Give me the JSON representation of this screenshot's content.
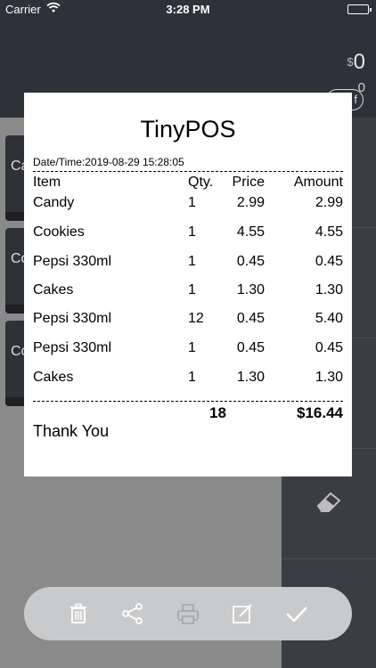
{
  "status": {
    "carrier": "Carrier",
    "time": "3:28 PM"
  },
  "header": {
    "currency": "$",
    "total": "0",
    "count": "0"
  },
  "left_cards": [
    "Ca",
    "Co",
    "Co"
  ],
  "receipt": {
    "title": "TinyPOS",
    "datetime": "Date/Time:2019-08-29 15:28:05",
    "columns": {
      "item": "Item",
      "qty": "Qty.",
      "price": "Price",
      "amount": "Amount"
    },
    "rows": [
      {
        "item": "Candy",
        "qty": "1",
        "price": "2.99",
        "amount": "2.99"
      },
      {
        "item": "Cookies",
        "qty": "1",
        "price": "4.55",
        "amount": "4.55"
      },
      {
        "item": "Pepsi 330ml",
        "qty": "1",
        "price": "0.45",
        "amount": "0.45"
      },
      {
        "item": "Cakes",
        "qty": "1",
        "price": "1.30",
        "amount": "1.30"
      },
      {
        "item": "Pepsi 330ml",
        "qty": "12",
        "price": "0.45",
        "amount": "5.40"
      },
      {
        "item": "Pepsi 330ml",
        "qty": "1",
        "price": "0.45",
        "amount": "0.45"
      },
      {
        "item": "Cakes",
        "qty": "1",
        "price": "1.30",
        "amount": "1.30"
      }
    ],
    "total_qty": "18",
    "total_amount": "$16.44",
    "footer": "Thank You"
  },
  "toolbar": {
    "icons": [
      "trash-icon",
      "share-icon",
      "print-icon",
      "edit-icon",
      "checkmark-icon"
    ]
  },
  "colors": {
    "header_bg": "#2d323a",
    "toolbar_bg": "#c9cacc",
    "battery": "#4cd964"
  }
}
